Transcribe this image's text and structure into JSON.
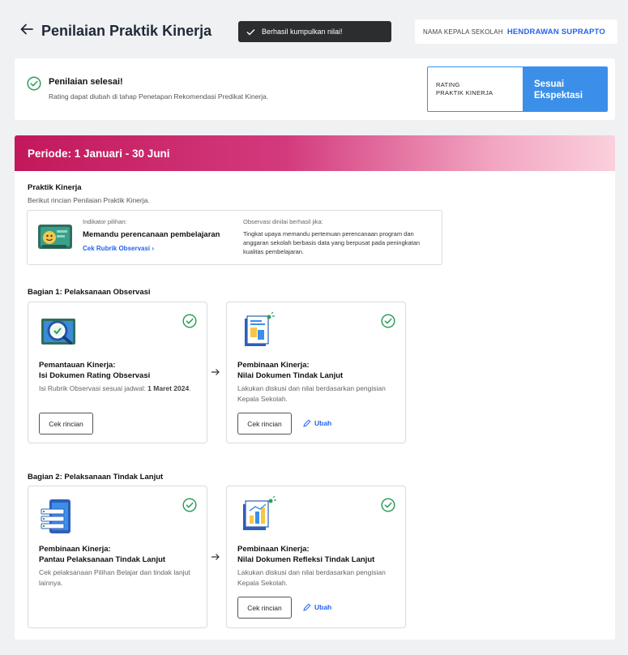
{
  "header": {
    "title": "Penilaian Praktik Kinerja",
    "toast": "Berhasil kumpulkan nilai!",
    "kepsek_label": "NAMA KEPALA SEKOLAH",
    "kepsek_name": "HENDRAWAN SUPRAPTO"
  },
  "status": {
    "title": "Penilaian selesai!",
    "subtitle": "Rating dapat diubah di tahap Penetapan Rekomendasi Predikat Kinerja.",
    "rating_label_line1": "RATING",
    "rating_label_line2": "PRAKTIK KINERJA",
    "rating_value_line1": "Sesuai",
    "rating_value_line2": "Ekspektasi"
  },
  "periode": "Periode: 1 Januari - 30 Juni",
  "praktik": {
    "title": "Praktik Kinerja",
    "subtitle": "Berikut rincian Penilaian Praktik Kinerja.",
    "indikator_label": "Indikator pilihan:",
    "indikator_value": "Memandu perencanaan pembelajaran",
    "rubrik_link": "Cek Rubrik Observasi ›",
    "observasi_label": "Observasi dinilai berhasil jika:",
    "observasi_text": "Tingkat upaya memandu pertemuan perencanaan program dan anggaran sekolah berbasis data yang berpusat pada peningkatan kualitas pembelajaran."
  },
  "bagian1": {
    "title": "Bagian 1: Pelaksanaan Observasi",
    "card1": {
      "title_line1": "Pemantauan Kinerja:",
      "title_line2": "Isi Dokumen Rating Observasi",
      "desc": "Isi Rubrik Observasi sesuai jadwal: ",
      "desc_bold": "1 Maret 2024",
      "desc_end": ".",
      "button": "Cek rincian"
    },
    "card2": {
      "title_line1": "Pembinaan Kinerja:",
      "title_line2": "Nilai Dokumen Tindak Lanjut",
      "desc": "Lakukan diskusi dan nilai berdasarkan pengisian Kepala Sekolah.",
      "button": "Cek rincian",
      "edit": "Ubah"
    }
  },
  "bagian2": {
    "title": "Bagian 2: Pelaksanaan Tindak Lanjut",
    "card1": {
      "title_line1": "Pembinaan Kinerja:",
      "title_line2": "Pantau Pelaksanaan Tindak Lanjut",
      "desc": "Cek pelaksanaan Pilihan Belajar dan tindak lanjut lainnya."
    },
    "card2": {
      "title_line1": "Pembinaan Kinerja:",
      "title_line2": "Nilai Dokumen Refleksi Tindak Lanjut",
      "desc": "Lakukan diskusi dan nilai berdasarkan pengisian Kepala Sekolah.",
      "button": "Cek rincian",
      "edit": "Ubah"
    }
  },
  "colors": {
    "accent": "#2563eb",
    "rating_bg": "#3b8fe8",
    "success": "#2e9e5b",
    "periode_start": "#c2185b",
    "periode_end": "#fbd0dd"
  }
}
